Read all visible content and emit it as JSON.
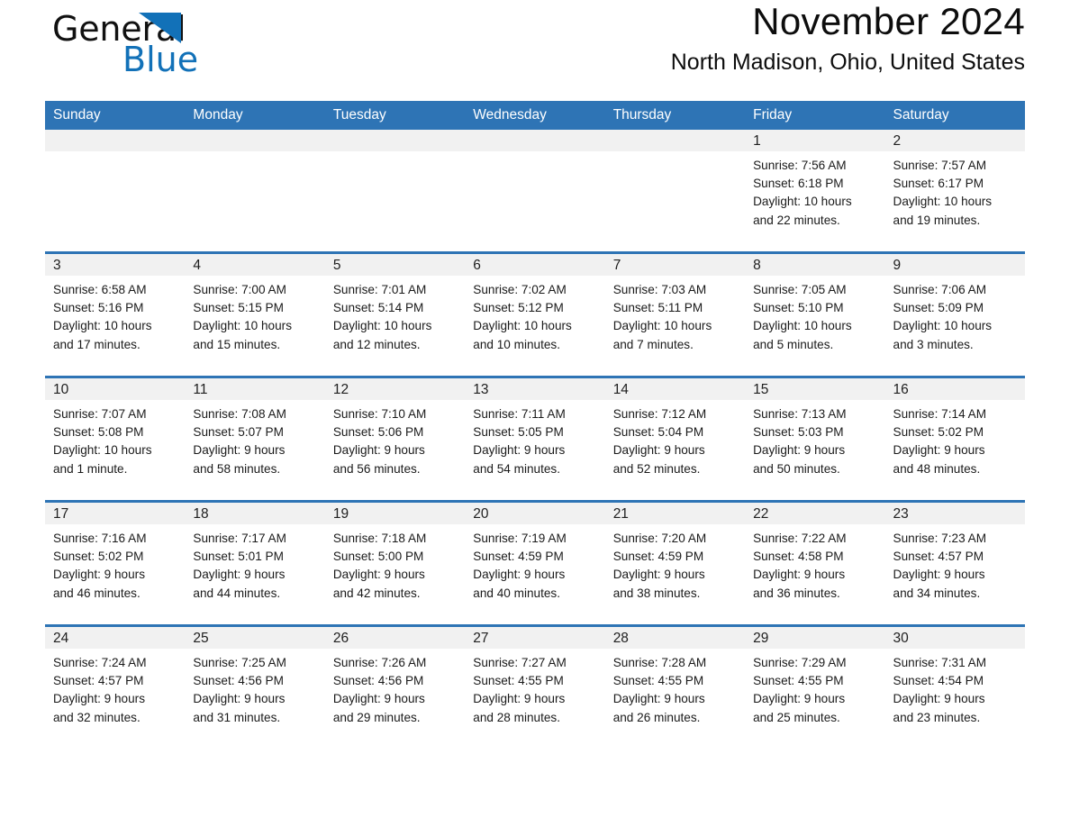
{
  "brand": {
    "name_part1": "General",
    "name_part2": "Blue",
    "logo_icon": "triangle-icon",
    "accent_color": "#1271b8"
  },
  "header": {
    "month_title": "November 2024",
    "location": "North Madison, Ohio, United States"
  },
  "theme": {
    "header_blue": "#2e74b5",
    "daynum_band": "#f1f1f1",
    "text": "#1a1a1a"
  },
  "calendar": {
    "weekday_headers": [
      "Sunday",
      "Monday",
      "Tuesday",
      "Wednesday",
      "Thursday",
      "Friday",
      "Saturday"
    ],
    "weeks": [
      [
        {
          "empty": true,
          "day": "",
          "sunrise": "",
          "sunset": "",
          "daylight_line1": "",
          "daylight_line2": ""
        },
        {
          "empty": true,
          "day": "",
          "sunrise": "",
          "sunset": "",
          "daylight_line1": "",
          "daylight_line2": ""
        },
        {
          "empty": true,
          "day": "",
          "sunrise": "",
          "sunset": "",
          "daylight_line1": "",
          "daylight_line2": ""
        },
        {
          "empty": true,
          "day": "",
          "sunrise": "",
          "sunset": "",
          "daylight_line1": "",
          "daylight_line2": ""
        },
        {
          "empty": true,
          "day": "",
          "sunrise": "",
          "sunset": "",
          "daylight_line1": "",
          "daylight_line2": ""
        },
        {
          "empty": false,
          "day": "1",
          "sunrise": "Sunrise: 7:56 AM",
          "sunset": "Sunset: 6:18 PM",
          "daylight_line1": "Daylight: 10 hours",
          "daylight_line2": "and 22 minutes."
        },
        {
          "empty": false,
          "day": "2",
          "sunrise": "Sunrise: 7:57 AM",
          "sunset": "Sunset: 6:17 PM",
          "daylight_line1": "Daylight: 10 hours",
          "daylight_line2": "and 19 minutes."
        }
      ],
      [
        {
          "empty": false,
          "day": "3",
          "sunrise": "Sunrise: 6:58 AM",
          "sunset": "Sunset: 5:16 PM",
          "daylight_line1": "Daylight: 10 hours",
          "daylight_line2": "and 17 minutes."
        },
        {
          "empty": false,
          "day": "4",
          "sunrise": "Sunrise: 7:00 AM",
          "sunset": "Sunset: 5:15 PM",
          "daylight_line1": "Daylight: 10 hours",
          "daylight_line2": "and 15 minutes."
        },
        {
          "empty": false,
          "day": "5",
          "sunrise": "Sunrise: 7:01 AM",
          "sunset": "Sunset: 5:14 PM",
          "daylight_line1": "Daylight: 10 hours",
          "daylight_line2": "and 12 minutes."
        },
        {
          "empty": false,
          "day": "6",
          "sunrise": "Sunrise: 7:02 AM",
          "sunset": "Sunset: 5:12 PM",
          "daylight_line1": "Daylight: 10 hours",
          "daylight_line2": "and 10 minutes."
        },
        {
          "empty": false,
          "day": "7",
          "sunrise": "Sunrise: 7:03 AM",
          "sunset": "Sunset: 5:11 PM",
          "daylight_line1": "Daylight: 10 hours",
          "daylight_line2": "and 7 minutes."
        },
        {
          "empty": false,
          "day": "8",
          "sunrise": "Sunrise: 7:05 AM",
          "sunset": "Sunset: 5:10 PM",
          "daylight_line1": "Daylight: 10 hours",
          "daylight_line2": "and 5 minutes."
        },
        {
          "empty": false,
          "day": "9",
          "sunrise": "Sunrise: 7:06 AM",
          "sunset": "Sunset: 5:09 PM",
          "daylight_line1": "Daylight: 10 hours",
          "daylight_line2": "and 3 minutes."
        }
      ],
      [
        {
          "empty": false,
          "day": "10",
          "sunrise": "Sunrise: 7:07 AM",
          "sunset": "Sunset: 5:08 PM",
          "daylight_line1": "Daylight: 10 hours",
          "daylight_line2": "and 1 minute."
        },
        {
          "empty": false,
          "day": "11",
          "sunrise": "Sunrise: 7:08 AM",
          "sunset": "Sunset: 5:07 PM",
          "daylight_line1": "Daylight: 9 hours",
          "daylight_line2": "and 58 minutes."
        },
        {
          "empty": false,
          "day": "12",
          "sunrise": "Sunrise: 7:10 AM",
          "sunset": "Sunset: 5:06 PM",
          "daylight_line1": "Daylight: 9 hours",
          "daylight_line2": "and 56 minutes."
        },
        {
          "empty": false,
          "day": "13",
          "sunrise": "Sunrise: 7:11 AM",
          "sunset": "Sunset: 5:05 PM",
          "daylight_line1": "Daylight: 9 hours",
          "daylight_line2": "and 54 minutes."
        },
        {
          "empty": false,
          "day": "14",
          "sunrise": "Sunrise: 7:12 AM",
          "sunset": "Sunset: 5:04 PM",
          "daylight_line1": "Daylight: 9 hours",
          "daylight_line2": "and 52 minutes."
        },
        {
          "empty": false,
          "day": "15",
          "sunrise": "Sunrise: 7:13 AM",
          "sunset": "Sunset: 5:03 PM",
          "daylight_line1": "Daylight: 9 hours",
          "daylight_line2": "and 50 minutes."
        },
        {
          "empty": false,
          "day": "16",
          "sunrise": "Sunrise: 7:14 AM",
          "sunset": "Sunset: 5:02 PM",
          "daylight_line1": "Daylight: 9 hours",
          "daylight_line2": "and 48 minutes."
        }
      ],
      [
        {
          "empty": false,
          "day": "17",
          "sunrise": "Sunrise: 7:16 AM",
          "sunset": "Sunset: 5:02 PM",
          "daylight_line1": "Daylight: 9 hours",
          "daylight_line2": "and 46 minutes."
        },
        {
          "empty": false,
          "day": "18",
          "sunrise": "Sunrise: 7:17 AM",
          "sunset": "Sunset: 5:01 PM",
          "daylight_line1": "Daylight: 9 hours",
          "daylight_line2": "and 44 minutes."
        },
        {
          "empty": false,
          "day": "19",
          "sunrise": "Sunrise: 7:18 AM",
          "sunset": "Sunset: 5:00 PM",
          "daylight_line1": "Daylight: 9 hours",
          "daylight_line2": "and 42 minutes."
        },
        {
          "empty": false,
          "day": "20",
          "sunrise": "Sunrise: 7:19 AM",
          "sunset": "Sunset: 4:59 PM",
          "daylight_line1": "Daylight: 9 hours",
          "daylight_line2": "and 40 minutes."
        },
        {
          "empty": false,
          "day": "21",
          "sunrise": "Sunrise: 7:20 AM",
          "sunset": "Sunset: 4:59 PM",
          "daylight_line1": "Daylight: 9 hours",
          "daylight_line2": "and 38 minutes."
        },
        {
          "empty": false,
          "day": "22",
          "sunrise": "Sunrise: 7:22 AM",
          "sunset": "Sunset: 4:58 PM",
          "daylight_line1": "Daylight: 9 hours",
          "daylight_line2": "and 36 minutes."
        },
        {
          "empty": false,
          "day": "23",
          "sunrise": "Sunrise: 7:23 AM",
          "sunset": "Sunset: 4:57 PM",
          "daylight_line1": "Daylight: 9 hours",
          "daylight_line2": "and 34 minutes."
        }
      ],
      [
        {
          "empty": false,
          "day": "24",
          "sunrise": "Sunrise: 7:24 AM",
          "sunset": "Sunset: 4:57 PM",
          "daylight_line1": "Daylight: 9 hours",
          "daylight_line2": "and 32 minutes."
        },
        {
          "empty": false,
          "day": "25",
          "sunrise": "Sunrise: 7:25 AM",
          "sunset": "Sunset: 4:56 PM",
          "daylight_line1": "Daylight: 9 hours",
          "daylight_line2": "and 31 minutes."
        },
        {
          "empty": false,
          "day": "26",
          "sunrise": "Sunrise: 7:26 AM",
          "sunset": "Sunset: 4:56 PM",
          "daylight_line1": "Daylight: 9 hours",
          "daylight_line2": "and 29 minutes."
        },
        {
          "empty": false,
          "day": "27",
          "sunrise": "Sunrise: 7:27 AM",
          "sunset": "Sunset: 4:55 PM",
          "daylight_line1": "Daylight: 9 hours",
          "daylight_line2": "and 28 minutes."
        },
        {
          "empty": false,
          "day": "28",
          "sunrise": "Sunrise: 7:28 AM",
          "sunset": "Sunset: 4:55 PM",
          "daylight_line1": "Daylight: 9 hours",
          "daylight_line2": "and 26 minutes."
        },
        {
          "empty": false,
          "day": "29",
          "sunrise": "Sunrise: 7:29 AM",
          "sunset": "Sunset: 4:55 PM",
          "daylight_line1": "Daylight: 9 hours",
          "daylight_line2": "and 25 minutes."
        },
        {
          "empty": false,
          "day": "30",
          "sunrise": "Sunrise: 7:31 AM",
          "sunset": "Sunset: 4:54 PM",
          "daylight_line1": "Daylight: 9 hours",
          "daylight_line2": "and 23 minutes."
        }
      ]
    ]
  }
}
